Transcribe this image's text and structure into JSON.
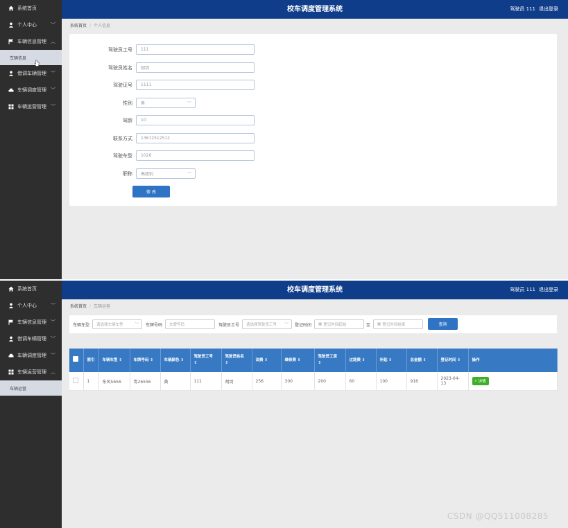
{
  "app": {
    "title": "校车调度管理系统",
    "user_label": "驾驶员 111",
    "logout_label": "退出登录"
  },
  "screen1": {
    "sidebar": {
      "items": [
        {
          "label": "系统首页",
          "icon": "home-icon",
          "chevron": ""
        },
        {
          "label": "个人中心",
          "icon": "person-icon",
          "chevron": "﹀"
        },
        {
          "label": "车辆信息管理",
          "icon": "flag-icon",
          "chevron": "︿"
        },
        {
          "label": "借调车辆管理",
          "icon": "person-icon",
          "chevron": "﹀"
        },
        {
          "label": "车辆调度管理",
          "icon": "car-icon",
          "chevron": "﹀"
        },
        {
          "label": "车辆运营管理",
          "icon": "grid-icon",
          "chevron": "﹀"
        }
      ],
      "sub_item": "车辆信息"
    },
    "breadcrumb": {
      "home": "系统首页",
      "current": "个人信息"
    },
    "form": {
      "fields": [
        {
          "label": "驾驶员工号",
          "value": "111"
        },
        {
          "label": "驾驶员姓名",
          "value": "胡玥"
        },
        {
          "label": "驾驶证号",
          "value": "1111"
        },
        {
          "label": "性别",
          "value": "男"
        },
        {
          "label": "驾龄",
          "value": "10"
        },
        {
          "label": "联系方式",
          "value": "13612512512"
        },
        {
          "label": "驾驶车型",
          "value": "1026"
        },
        {
          "label": "职称",
          "value": "高级别"
        }
      ],
      "submit_label": "修 改"
    }
  },
  "screen2": {
    "sidebar": {
      "items": [
        {
          "label": "系统首页",
          "icon": "home-icon",
          "chevron": ""
        },
        {
          "label": "个人中心",
          "icon": "person-icon",
          "chevron": "﹀"
        },
        {
          "label": "车辆信息管理",
          "icon": "flag-icon",
          "chevron": "﹀"
        },
        {
          "label": "借调车辆管理",
          "icon": "person-icon",
          "chevron": "﹀"
        },
        {
          "label": "车辆调度管理",
          "icon": "car-icon",
          "chevron": "﹀"
        },
        {
          "label": "车辆运营管理",
          "icon": "grid-icon",
          "chevron": "︿"
        }
      ],
      "sub_item": "车辆运营"
    },
    "breadcrumb": {
      "home": "系统首页",
      "current": "车辆运营"
    },
    "search": {
      "vehicle_type_label": "车辆车型",
      "vehicle_type_placeholder": "请选择车辆车型",
      "plate_label": "车牌号码",
      "plate_placeholder": "车牌号码",
      "driver_id_label": "驾驶员工号",
      "driver_id_placeholder": "请选择驾驶员工号",
      "reg_time_label": "登记时间",
      "reg_start_placeholder": "登记时间起始",
      "to_label": "至",
      "reg_end_placeholder": "登记时间结束",
      "query_label": "查询"
    },
    "table": {
      "headers": [
        "索引",
        "车辆车型 ⇕",
        "车牌号码 ⇕",
        "车辆颜色 ⇕",
        "驾驶员工号 ⇕",
        "驾驶员姓名 ⇕",
        "油费 ⇕",
        "维修费 ⇕",
        "驾驶员工资 ⇕",
        "过路费 ⇕",
        "补贴 ⇕",
        "总金额 ⇕",
        "登记时间 ⇕",
        "操作"
      ],
      "rows": [
        {
          "cells": [
            "1",
            "东风5656",
            "粤26556",
            "黄",
            "111",
            "胡玥",
            "256",
            "300",
            "200",
            "60",
            "100",
            "916",
            "2023-04-13"
          ],
          "action": "详情"
        }
      ]
    }
  },
  "watermark": "CSDN @QQ511008285"
}
